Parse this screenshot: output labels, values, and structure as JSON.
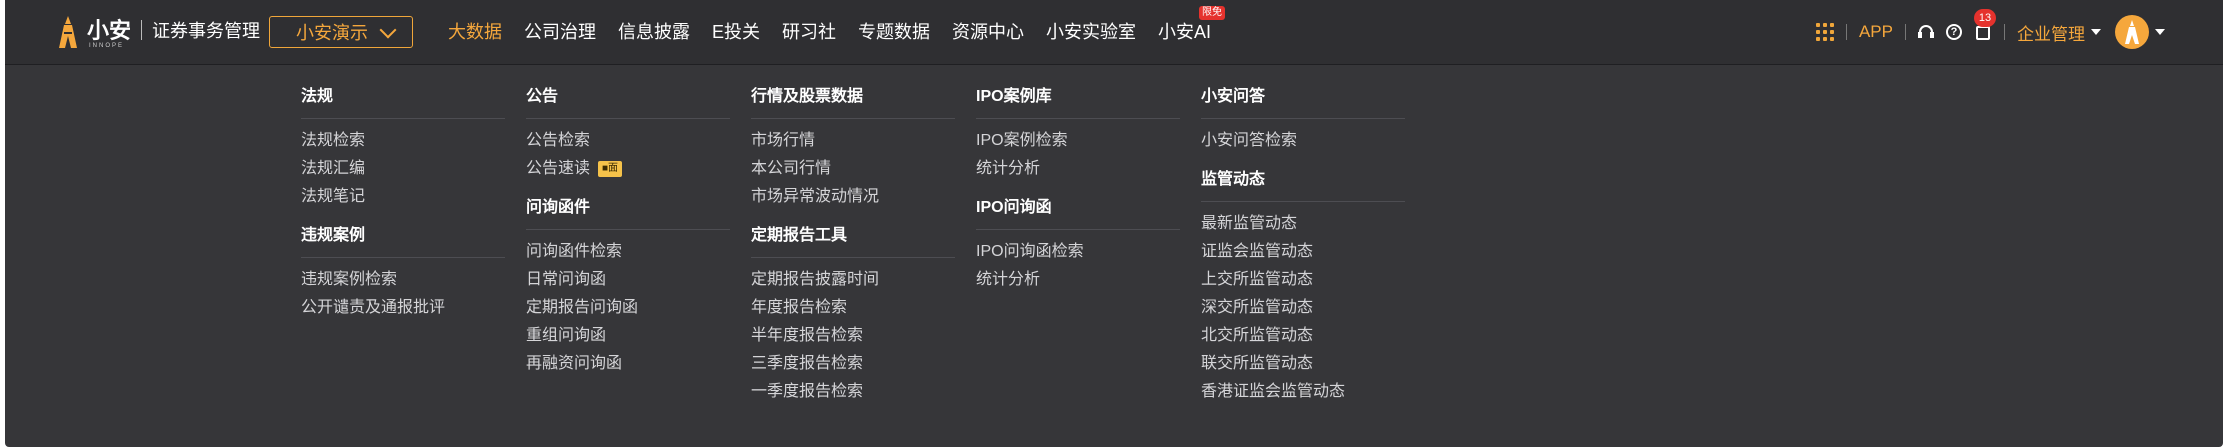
{
  "brand": {
    "name": "小安",
    "sub": "INNOPE",
    "app_title": "证券事务管理"
  },
  "org_select": {
    "value": "小安演示"
  },
  "nav": [
    {
      "label": "大数据",
      "active": true
    },
    {
      "label": "公司治理"
    },
    {
      "label": "信息披露"
    },
    {
      "label": "E投关"
    },
    {
      "label": "研习社"
    },
    {
      "label": "专题数据"
    },
    {
      "label": "资源中心"
    },
    {
      "label": "小安实验室"
    },
    {
      "label": "小安AI",
      "badge": "限免"
    }
  ],
  "right": {
    "app_label": "APP",
    "help_symbol": "?",
    "message_count": "13",
    "enterprise_label": "企业管理"
  },
  "menu": {
    "col1": {
      "sec1": {
        "title": "法规",
        "items": [
          "法规检索",
          "法规汇编",
          "法规笔记"
        ]
      },
      "sec2": {
        "title": "违规案例",
        "items": [
          "违规案例检索",
          "公开谴责及通报批评"
        ]
      }
    },
    "col2": {
      "sec1": {
        "title": "公告",
        "items": [
          "公告检索",
          "公告速读"
        ],
        "vip_label": "■面"
      },
      "sec2": {
        "title": "问询函件",
        "items": [
          "问询函件检索",
          "日常问询函",
          "定期报告问询函",
          "重组问询函",
          "再融资问询函"
        ]
      }
    },
    "col3": {
      "sec1": {
        "title": "行情及股票数据",
        "items": [
          "市场行情",
          "本公司行情",
          "市场异常波动情况"
        ]
      },
      "sec2": {
        "title": "定期报告工具",
        "items": [
          "定期报告披露时间",
          "年度报告检索",
          "半年度报告检索",
          "三季度报告检索",
          "一季度报告检索"
        ]
      }
    },
    "col4": {
      "sec1": {
        "title": "IPO案例库",
        "items": [
          "IPO案例检索",
          "统计分析"
        ]
      },
      "sec2": {
        "title": "IPO问询函",
        "items": [
          "IPO问询函检索",
          "统计分析"
        ]
      }
    },
    "col5": {
      "sec1": {
        "title": "小安问答",
        "items": [
          "小安问答检索"
        ]
      },
      "sec2": {
        "title": "监管动态",
        "items": [
          "最新监管动态",
          "证监会监管动态",
          "上交所监管动态",
          "深交所监管动态",
          "北交所监管动态",
          "联交所监管动态",
          "香港证监会监管动态"
        ]
      }
    }
  },
  "colors": {
    "accent": "#f5a73c",
    "nav_bg": "#2f2f32",
    "menu_bg": "#363639",
    "badge_red": "#e5322d"
  }
}
